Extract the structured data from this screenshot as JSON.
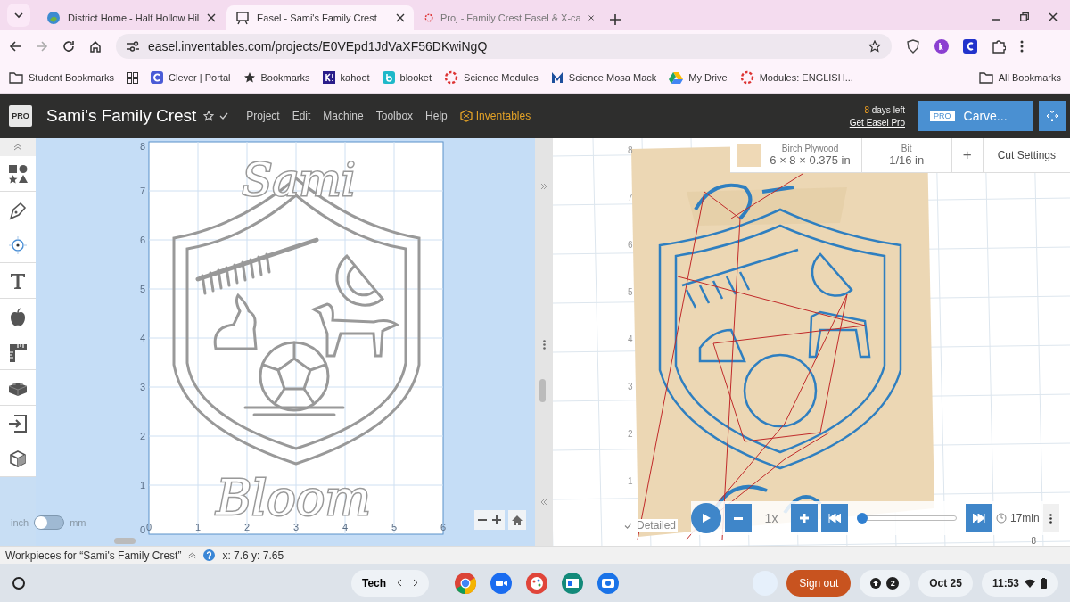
{
  "browser": {
    "tabs": [
      {
        "title": "District Home - Half Hollow Hil",
        "selected": false
      },
      {
        "title": "Easel - Sami's Family Crest",
        "selected": true
      },
      {
        "title": "Proj - Family Crest Easel & X-ca",
        "selected": false
      }
    ],
    "address": "easel.inventables.com/projects/E0VEpd1JdVaXF56DKwiNgQ",
    "bookmarks": [
      "Student Bookmarks",
      "Clever | Portal",
      "Bookmarks",
      "kahoot",
      "blooket",
      "Science Modules",
      "Science Mosa Mack",
      "My Drive",
      "Modules: ENGLISH..."
    ],
    "all_bookmarks": "All Bookmarks"
  },
  "app": {
    "logo_badge": "PRO",
    "project_title": "Sami's Family Crest",
    "menu": [
      "Project",
      "Edit",
      "Machine",
      "Toolbox",
      "Help"
    ],
    "brand": "Inventables",
    "trial_days": "8",
    "trial_text": "days left",
    "upgrade_link": "Get Easel Pro",
    "carve_badge": "PRO",
    "carve_button": "Carve..."
  },
  "units": {
    "left": "inch",
    "right": "mm",
    "metric": false
  },
  "design": {
    "texts": [
      "Sami",
      "Bloom"
    ],
    "x_ticks": [
      "0",
      "1",
      "2",
      "3",
      "4",
      "5",
      "6"
    ],
    "y_ticks": [
      "8",
      "7",
      "6",
      "5",
      "4",
      "3",
      "2",
      "1",
      "0"
    ]
  },
  "preview": {
    "material": "Birch Plywood",
    "dimensions": "6 × 8 × 0.375 in",
    "bit_label": "Bit",
    "bit": "1/16 in",
    "add": "+",
    "cut_settings": "Cut Settings",
    "y_ticks": [
      "8",
      "7",
      "6",
      "5",
      "4",
      "3",
      "2",
      "1"
    ],
    "detailed": "Detailed",
    "detailed_checked": true,
    "speed": "1x",
    "level": 0,
    "time": "17min",
    "x_tick": "8"
  },
  "status_bar": {
    "workpieces": "Workpieces for “Sami's Family Crest”",
    "coords": "x: 7.6 y: 7.65"
  },
  "taskbar": {
    "desk": "Tech",
    "signout": "Sign out",
    "notifications": "2",
    "date": "Oct 25",
    "time": "11:53"
  }
}
